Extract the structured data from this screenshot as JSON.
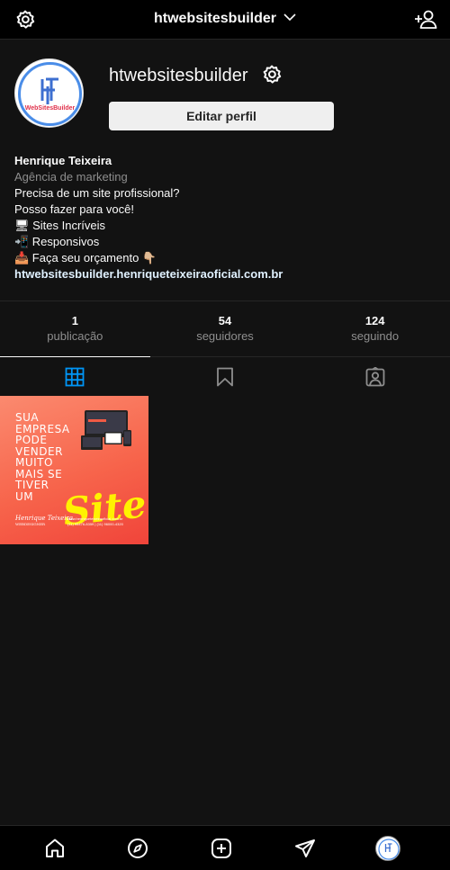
{
  "header": {
    "username": "htwebsitesbuilder"
  },
  "profile": {
    "username": "htwebsitesbuilder",
    "edit_label": "Editar perfil",
    "logo_text": "WebSitesBuilder",
    "logo_monogram": "H"
  },
  "bio": {
    "name": "Henrique Teixeira",
    "category": "Agência de marketing",
    "lines": [
      "Precisa de um site profissional?",
      "Posso fazer para você!",
      "🖥 Sites Incríveis",
      "📲 Responsivos",
      "📥 Faça seu orçamento 👇🏼"
    ],
    "link": "htwebsitesbuilder.henriqueteixeiraoficial.com.br"
  },
  "stats": [
    {
      "value": "1",
      "label": "publicação"
    },
    {
      "value": "54",
      "label": "seguidores"
    },
    {
      "value": "124",
      "label": "seguindo"
    }
  ],
  "tabs": [
    "grid-icon",
    "saved-icon",
    "tagged-icon"
  ],
  "post": {
    "headline": [
      "SUA",
      "EMPRESA",
      "PODE",
      "VENDER",
      "MUITO",
      "MAIS SE",
      "TIVER",
      "UM"
    ],
    "highlight": "Site",
    "signature": "Henrique Teixeira",
    "signature_sub": "WEBDESIGNER",
    "contact_lines": [
      "www.henriqueteixeiraoficial.com.br",
      "(11) 95476-8359   |   (11) 96000-4320"
    ]
  },
  "colors": {
    "accent": "#0095f6",
    "post_gradient_start": "#fb8a6f",
    "post_gradient_end": "#f0443a",
    "post_highlight": "#fff200"
  }
}
